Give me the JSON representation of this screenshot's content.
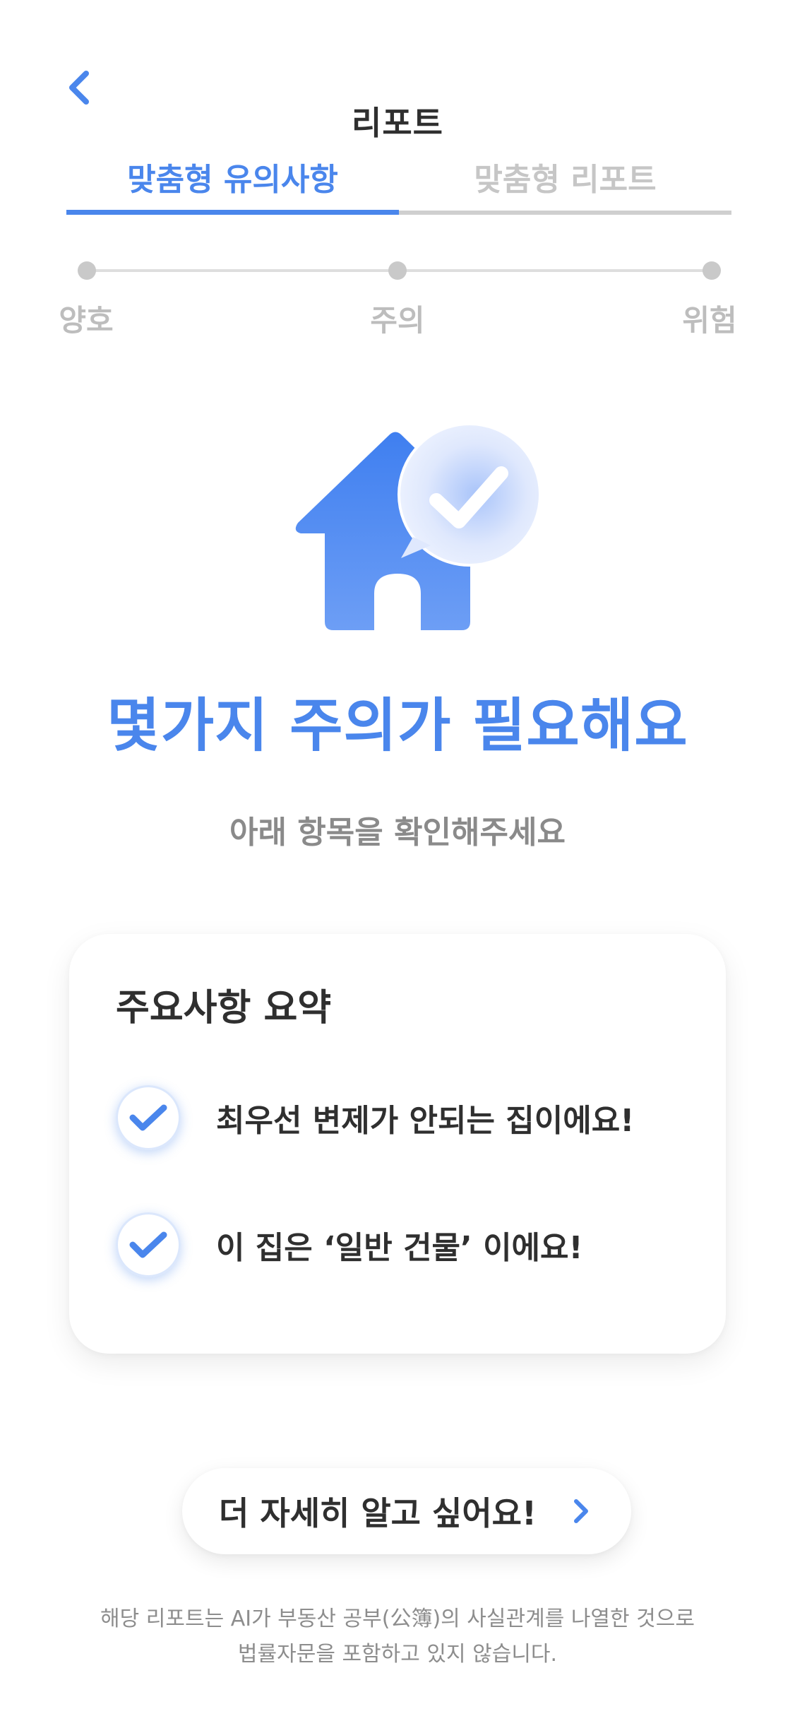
{
  "header": {
    "title": "리포트",
    "back_icon": "chevron-left-icon"
  },
  "tabs": [
    {
      "label": "맞춤형 유의사항",
      "active": true
    },
    {
      "label": "맞춤형 리포트",
      "active": false
    }
  ],
  "scale": {
    "levels": [
      "양호",
      "주의",
      "위험"
    ]
  },
  "hero": {
    "icon": "house-check-icon",
    "headline": "몇가지 주의가 필요해요",
    "subline": "아래 항목을 확인해주세요"
  },
  "summary": {
    "title": "주요사항 요약",
    "items": [
      {
        "text": "최우선 변제가 안되는 집이에요!",
        "icon": "check-icon"
      },
      {
        "text": "이 집은 ‘일반 건물’ 이에요!",
        "icon": "check-icon"
      }
    ]
  },
  "cta": {
    "label": "더 자세히 알고 싶어요!",
    "icon": "chevron-right-icon"
  },
  "disclaimer": {
    "line1": "해당 리포트는 AI가 부동산 공부(公簿)의 사실관계를 나열한 것으로",
    "line2": "법률자문을 포함하고 있지 않습니다."
  },
  "colors": {
    "accent": "#4a86ec",
    "inactive": "#c6c6c6",
    "text": "#2f2f2f",
    "muted": "#8a8a8a"
  }
}
